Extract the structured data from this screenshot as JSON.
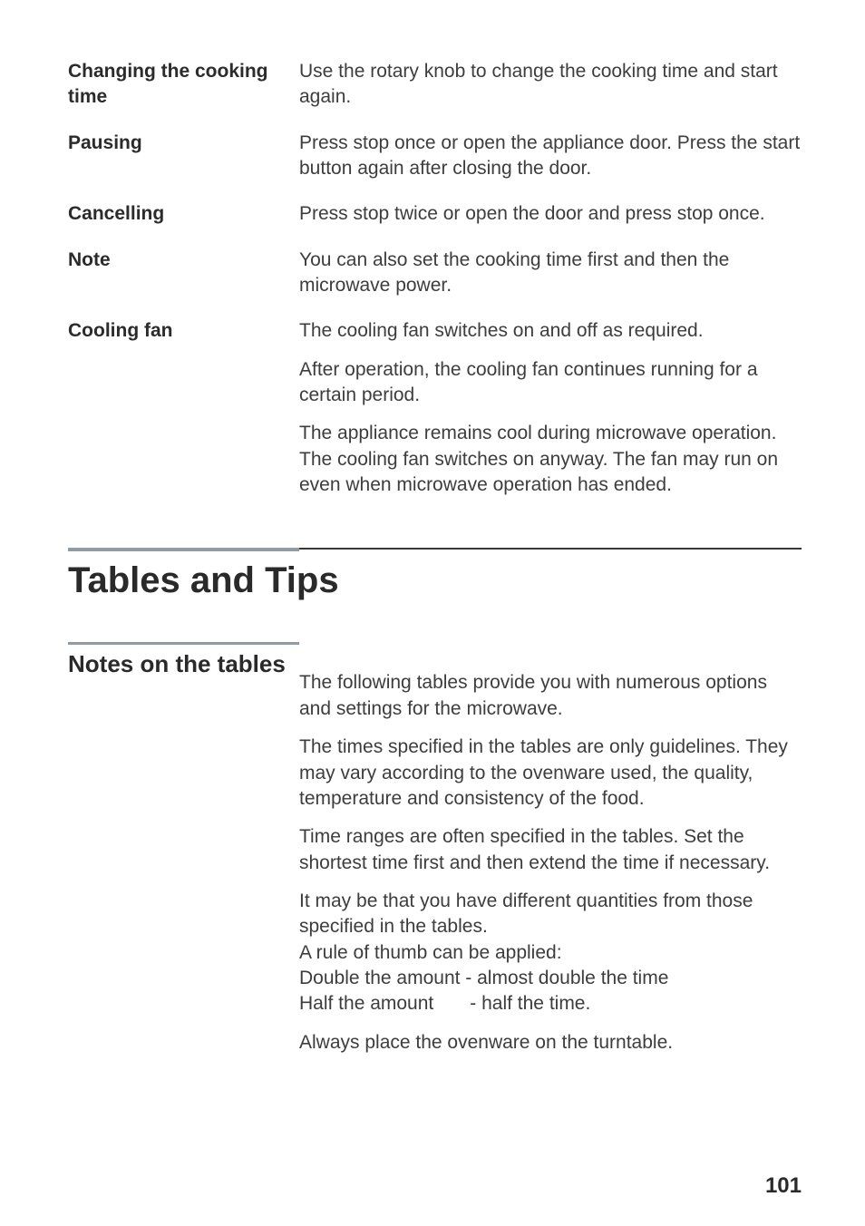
{
  "rows": [
    {
      "label": "Changing the cooking time",
      "text": "Use the rotary knob to change the cooking time and start again."
    },
    {
      "label": "Pausing",
      "text": "Press stop once or open the appliance door. Press the start button again after closing the door."
    },
    {
      "label": "Cancelling",
      "text": "Press stop twice or open the door and press stop once."
    },
    {
      "label": "Note",
      "text": "You can also set the cooking time first and then the microwave power."
    }
  ],
  "cooling": {
    "label": "Cooling fan",
    "p1": "The cooling fan switches on and off as required.",
    "p2": "After operation, the cooling fan continues running for a certain period.",
    "p3": "The appliance remains cool during microwave operation. The cooling fan switches on anyway. The fan may run on even when microwave operation has ended."
  },
  "h1": "Tables and Tips",
  "h2": "Notes on the tables",
  "notes": {
    "p1": "The following tables provide you with numerous options and settings for the microwave.",
    "p2": "The times specified in the tables are only guidelines. They may vary according to the ovenware used, the quality, temperature and consistency of the food.",
    "p3": "Time ranges are often specified in the tables. Set the shortest time first and then extend the time if necessary.",
    "p4a": "It may be that you have different quantities from those specified in the tables.",
    "p4b": "A rule of thumb can be applied:",
    "p4c": "Double the amount - almost double the time",
    "p4d_left": "Half the amount",
    "p4d_right": "- half the time.",
    "p5": "Always place the ovenware on the turntable."
  },
  "page_number": "101"
}
